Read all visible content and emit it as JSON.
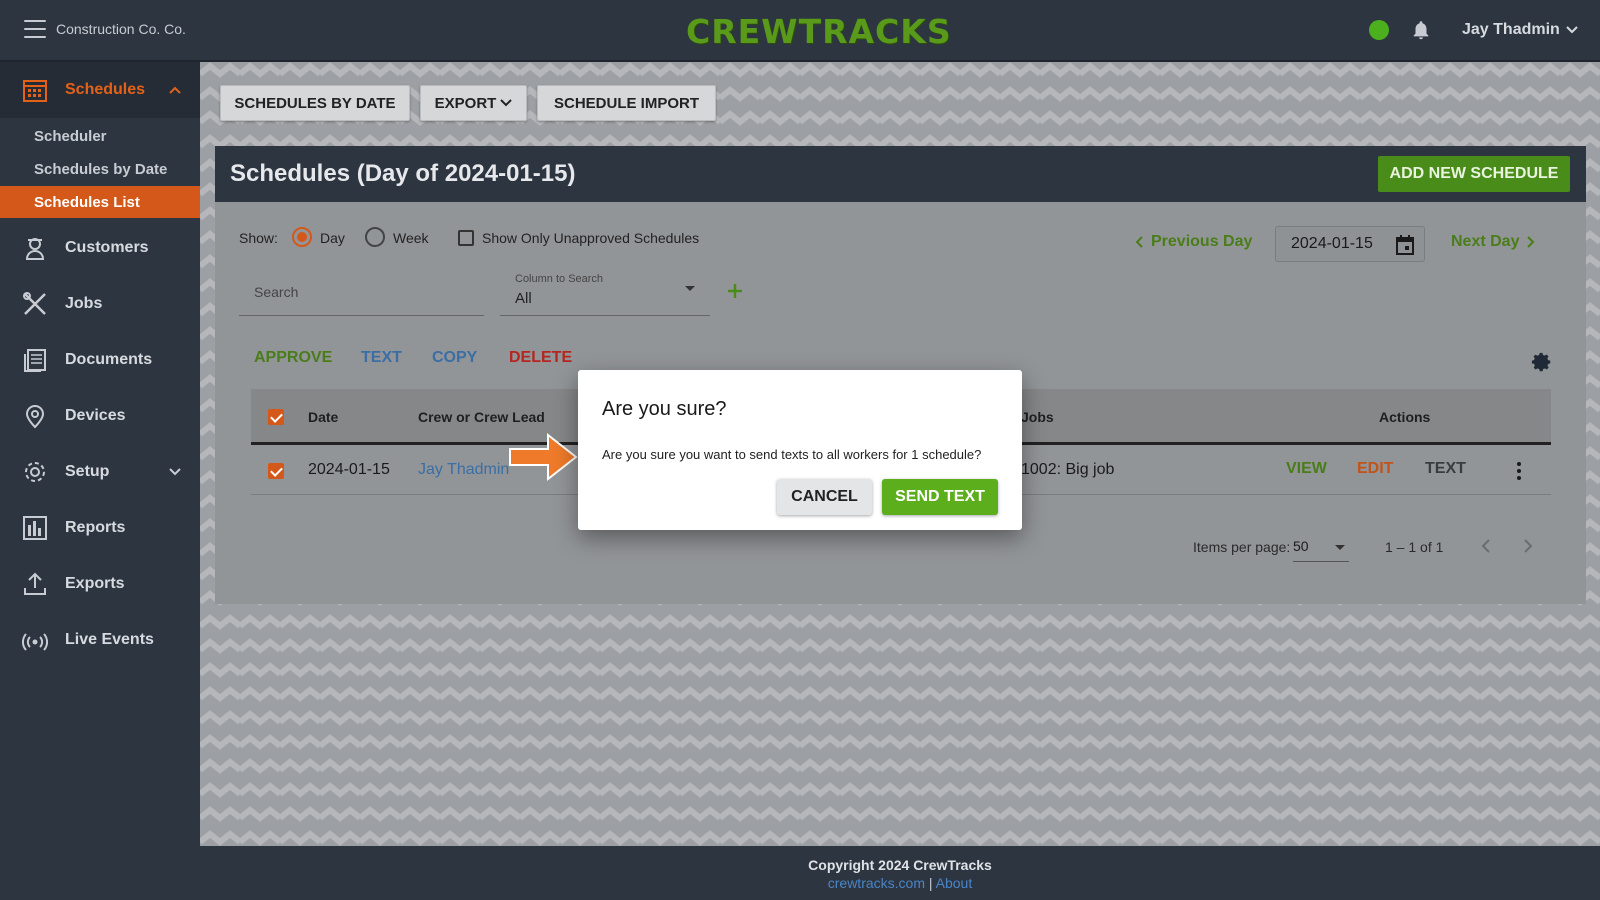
{
  "header": {
    "company": "Construction Co. Co.",
    "logo": "CREWTRACKS",
    "user": "Jay Thadmin",
    "status_color": "#4caf1d"
  },
  "sidebar": {
    "items": [
      {
        "label": "Schedules",
        "icon": "calendar-icon",
        "active": true
      },
      {
        "label": "Customers",
        "icon": "person-icon"
      },
      {
        "label": "Jobs",
        "icon": "tools-icon"
      },
      {
        "label": "Documents",
        "icon": "documents-icon"
      },
      {
        "label": "Devices",
        "icon": "location-pin-icon"
      },
      {
        "label": "Setup",
        "icon": "gear-icon"
      },
      {
        "label": "Reports",
        "icon": "bar-chart-icon"
      },
      {
        "label": "Exports",
        "icon": "upload-icon"
      },
      {
        "label": "Live Events",
        "icon": "broadcast-icon"
      }
    ],
    "subitems": [
      "Scheduler",
      "Schedules by Date",
      "Schedules List"
    ]
  },
  "toolbar": {
    "schedules_by_date": "SCHEDULES BY DATE",
    "export": "EXPORT",
    "schedule_import": "SCHEDULE IMPORT"
  },
  "card": {
    "title": "Schedules (Day of 2024-01-15)",
    "add_button": "ADD NEW SCHEDULE",
    "show_label": "Show:",
    "radio_day": "Day",
    "radio_week": "Week",
    "unapproved_label": "Show Only Unapproved Schedules",
    "prev_day": "Previous Day",
    "next_day": "Next Day",
    "date_value": "2024-01-15",
    "search_placeholder": "Search",
    "column_label": "Column to Search",
    "column_value": "All"
  },
  "actions": {
    "approve": "APPROVE",
    "text": "TEXT",
    "copy": "COPY",
    "delete": "DELETE"
  },
  "table": {
    "headers": {
      "date": "Date",
      "crew": "Crew or Crew Lead",
      "jobs": "Jobs",
      "actions": "Actions"
    },
    "rows": [
      {
        "date": "2024-01-15",
        "crew": "Jay Thadmin",
        "jobs": "1002: Big job",
        "view": "VIEW",
        "edit": "EDIT",
        "text": "TEXT"
      }
    ]
  },
  "pager": {
    "label": "Items per page:",
    "per_page": "50",
    "range": "1 – 1 of 1"
  },
  "footer": {
    "copyright": "Copyright 2024 CrewTracks",
    "site": "crewtracks.com",
    "separator": "|",
    "about": "About"
  },
  "dialog": {
    "title": "Are you sure?",
    "message": "Are you sure you want to send texts to all workers for 1 schedule?",
    "cancel": "CANCEL",
    "confirm": "SEND TEXT"
  }
}
